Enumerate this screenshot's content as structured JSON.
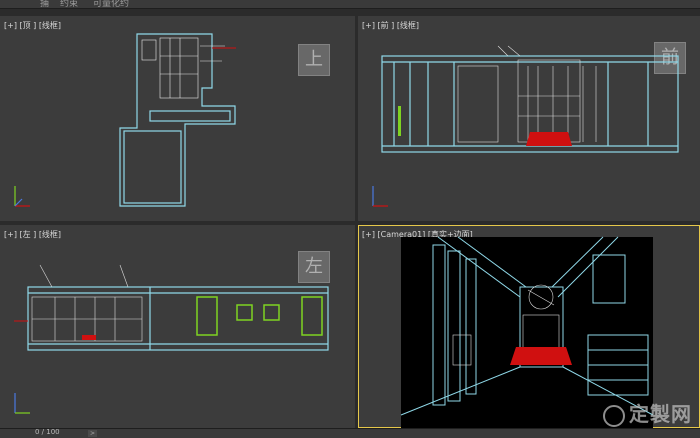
{
  "menu": {
    "items": [
      "捕",
      "约束",
      "可量化约"
    ]
  },
  "viewports": {
    "top": {
      "label": "[+] [顶 ] [线框]",
      "cube": "上"
    },
    "front": {
      "label": "[+] [前 ] [线框]",
      "cube": "前"
    },
    "left": {
      "label": "[+] [左 ] [线框]",
      "cube": "左"
    },
    "camera": {
      "label": "[+] [Camera01] [真实+边面]"
    }
  },
  "timeline": {
    "frame": "0 / 100",
    "next_label": ">"
  },
  "watermark": {
    "text": "定製网"
  },
  "colors": {
    "bg": "#3c3c3c",
    "wire": "#8fd8e8",
    "active_border": "#e6c84a",
    "red": "#d01010",
    "green": "#7ed321"
  }
}
